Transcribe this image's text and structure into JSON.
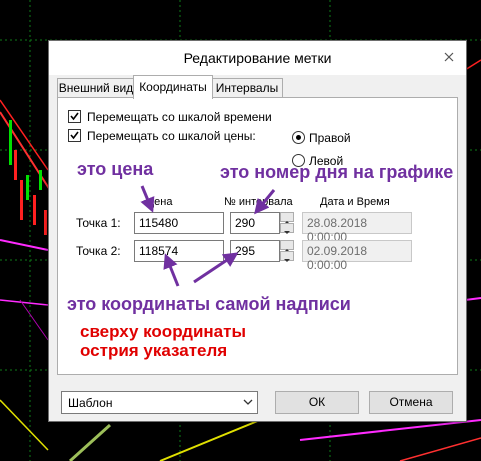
{
  "dialog": {
    "title": "Редактирование метки",
    "tabs": [
      {
        "label": "Внешний вид",
        "active": false
      },
      {
        "label": "Координаты",
        "active": true
      },
      {
        "label": "Интервалы",
        "active": false
      }
    ]
  },
  "coords": {
    "move_time_label": "Перемещать со шкалой времени",
    "move_price_label": "Перемещать со шкалой цены:",
    "radio_right": "Правой",
    "radio_left": "Левой",
    "col_price": "Цена",
    "col_interval": "№ интервала",
    "col_datetime": "Дата и Время",
    "points": [
      {
        "label": "Точка 1:",
        "price": "115480",
        "interval": "290",
        "datetime": "28.08.2018  0:00:00"
      },
      {
        "label": "Точка 2:",
        "price": "118574",
        "interval": "295",
        "datetime": "02.09.2018  0:00:00"
      }
    ]
  },
  "annotations": {
    "price_note": "это  цена",
    "interval_note": "это номер дня на графике",
    "coords_note": "это координаты самой надписи",
    "tip_note_line1": "сверху координаты",
    "tip_note_line2": "острия указателя"
  },
  "footer": {
    "template_label": "Шаблон",
    "ok_label": "ОК",
    "cancel_label": "Отмена"
  },
  "colors": {
    "annotation_purple": "#7030a0",
    "annotation_red": "#e00000"
  }
}
